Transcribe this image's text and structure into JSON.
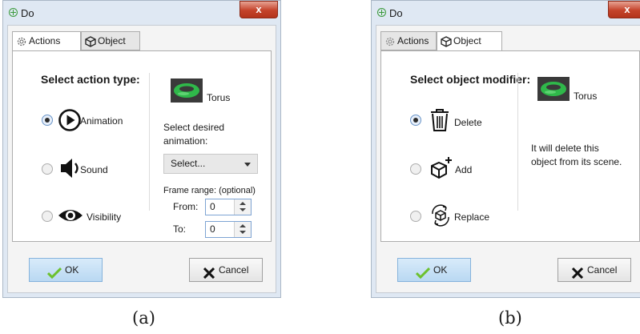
{
  "left": {
    "window_title": "Do",
    "close_glyph": "x",
    "tabs": [
      {
        "label": "Actions",
        "icon": "gear-icon"
      },
      {
        "label": "Object",
        "icon": "cube-icon"
      }
    ],
    "heading": "Select action type:",
    "object_name": "Torus",
    "options": [
      {
        "label": "Animation",
        "icon": "play-circle-icon",
        "selected": true
      },
      {
        "label": "Sound",
        "icon": "speaker-icon",
        "selected": false
      },
      {
        "label": "Visibility",
        "icon": "eye-icon",
        "selected": false
      }
    ],
    "animation_label_1": "Select desired",
    "animation_label_2": "animation:",
    "select_value": "Select...",
    "frame_range_label": "Frame range: (optional)",
    "from_label": "From:",
    "from_value": "0",
    "to_label": "To:",
    "to_value": "0",
    "ok_label": "OK",
    "cancel_label": "Cancel"
  },
  "right": {
    "window_title": "Do",
    "close_glyph": "x",
    "tabs": [
      {
        "label": "Actions",
        "icon": "gear-icon"
      },
      {
        "label": "Object",
        "icon": "cube-icon"
      }
    ],
    "heading": "Select object modifier:",
    "object_name": "Torus",
    "options": [
      {
        "label": "Delete",
        "icon": "trash-icon",
        "selected": true
      },
      {
        "label": "Add",
        "icon": "cube-plus-icon",
        "selected": false
      },
      {
        "label": "Replace",
        "icon": "replace-cube-icon",
        "selected": false
      }
    ],
    "description_1": "It will delete this",
    "description_2": "object from its scene.",
    "ok_label": "OK",
    "cancel_label": "Cancel"
  },
  "captions": [
    "(a)",
    "(b)"
  ],
  "colors": {
    "close_button": "#c4432a",
    "ok_button": "#b9d8f2",
    "torus": "#2fb84a"
  }
}
